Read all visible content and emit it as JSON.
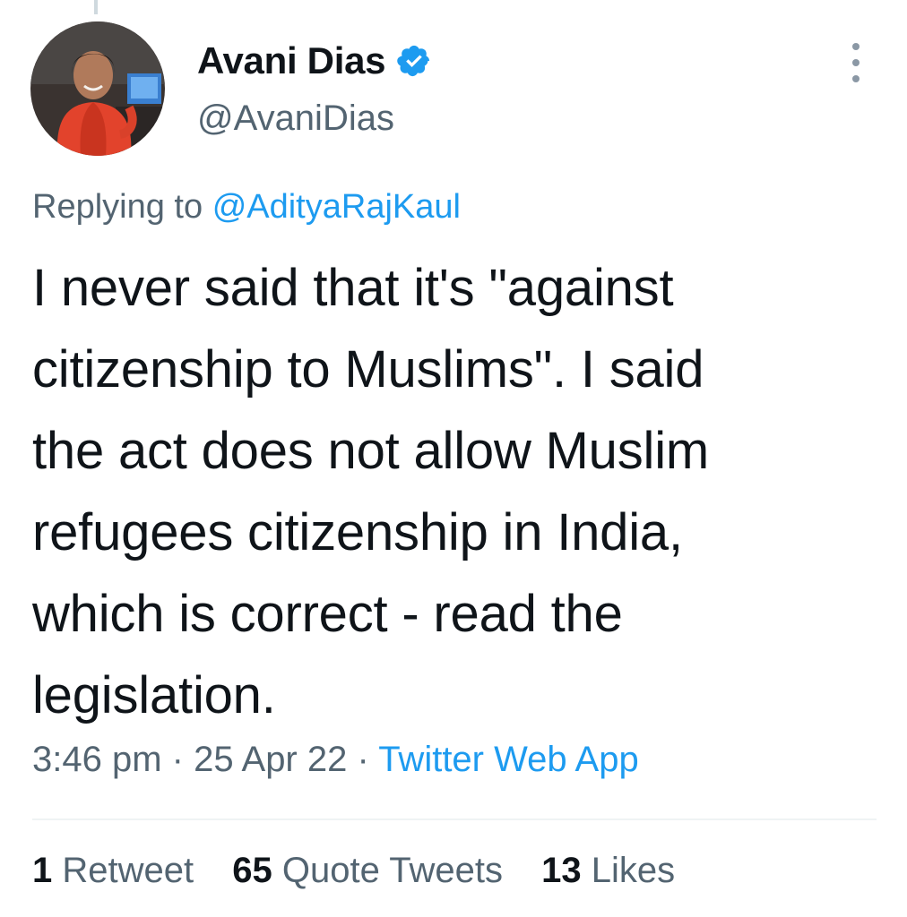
{
  "author": {
    "display_name": "Avani Dias",
    "handle": "@AvaniDias",
    "verified_icon": "verified-badge-icon",
    "avatar": "profile-photo"
  },
  "reply": {
    "prefix": "Replying to",
    "mention": "@AdityaRajKaul"
  },
  "tweet": {
    "lines": [
      "I never said that it's \"against",
      "citizenship to Muslims\". I said",
      "the act does not allow Muslim",
      "refugees citizenship in India,",
      "which is correct - read the",
      "legislation."
    ]
  },
  "meta": {
    "time": "3:46 pm",
    "date": "25 Apr 22",
    "separator": "·",
    "source": "Twitter Web App"
  },
  "stats": {
    "retweets_count": "1",
    "retweets_label": "Retweet",
    "quotes_count": "65",
    "quotes_label": "Quote Tweets",
    "likes_count": "13",
    "likes_label": "Likes"
  },
  "colors": {
    "accent": "#1d9bf0",
    "secondary_text": "#536471",
    "primary_text": "#0f1419"
  }
}
